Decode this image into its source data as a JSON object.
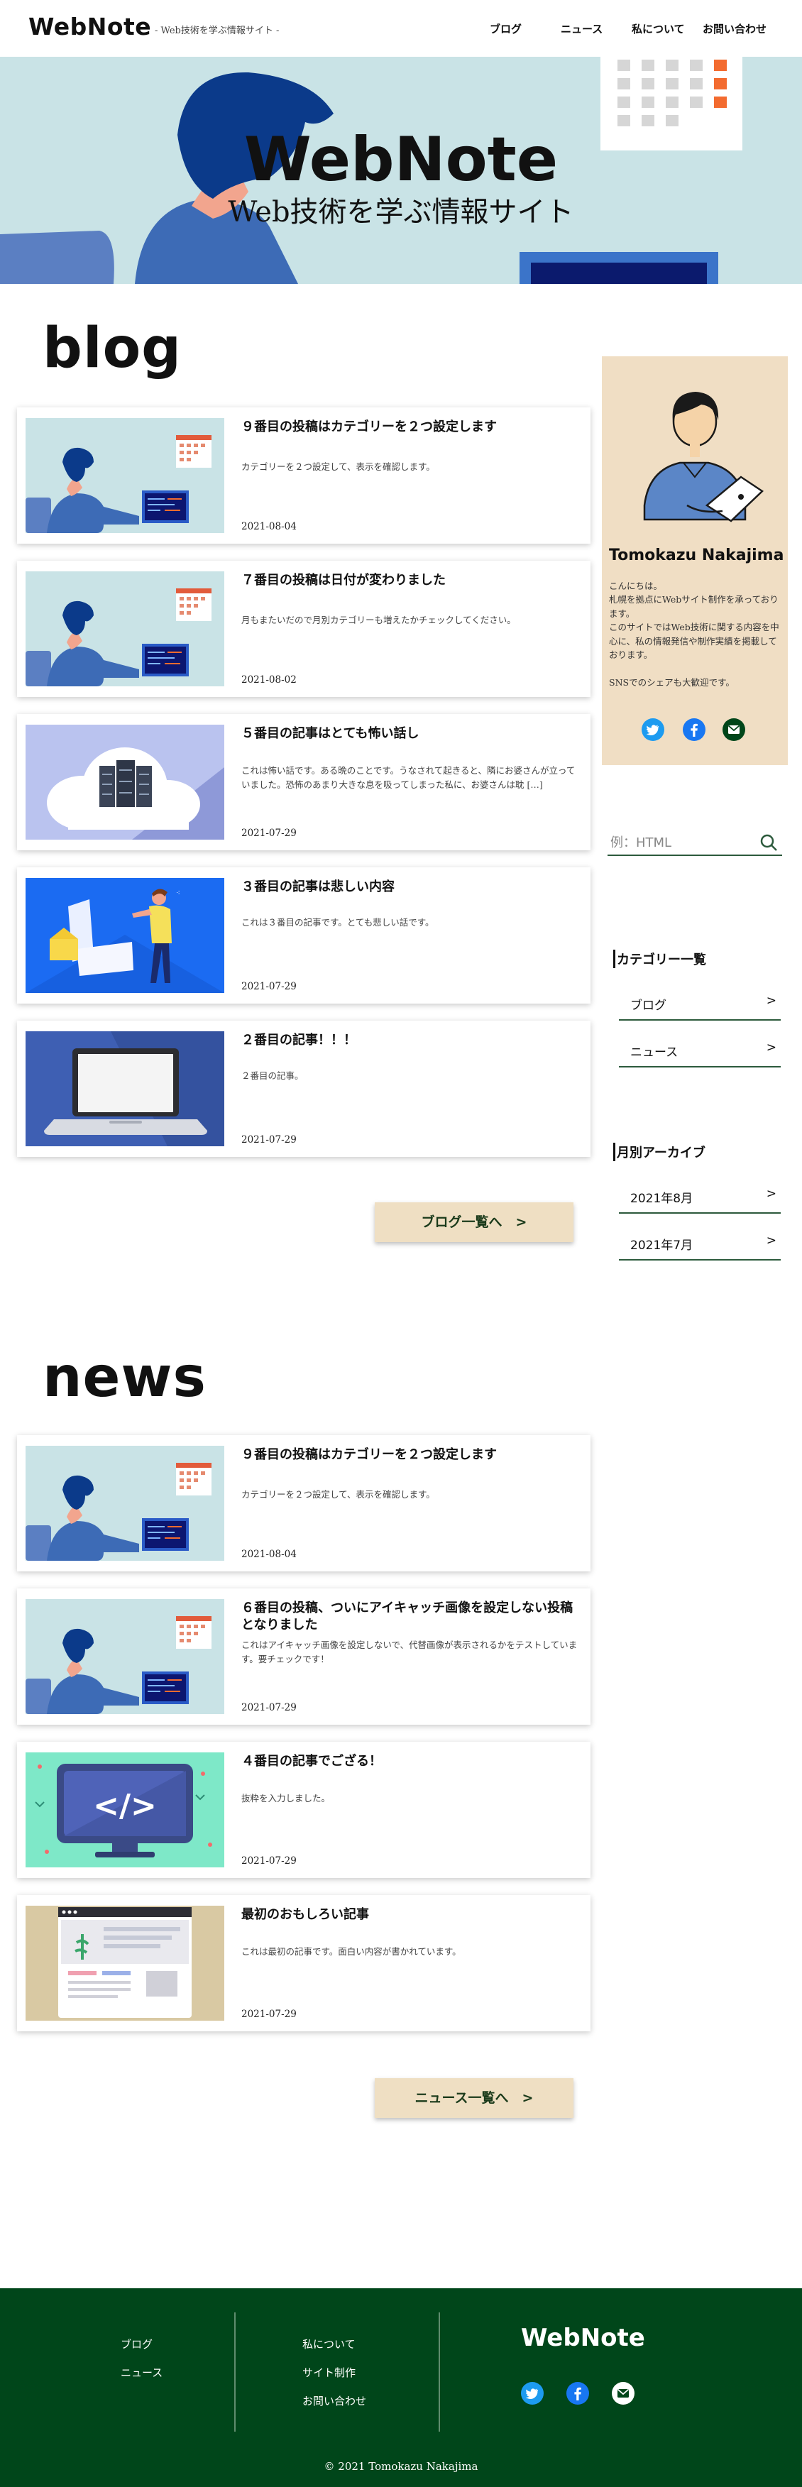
{
  "header": {
    "logo": "WebNote",
    "tagline": "- Web技術を学ぶ情報サイト -",
    "nav": [
      "ブログ",
      "ニュース",
      "私について",
      "お問い合わせ"
    ]
  },
  "hero": {
    "title": "WebNote",
    "subtitle": "Web技術を学ぶ情報サイト"
  },
  "blog": {
    "title": "blog",
    "posts": [
      {
        "title": "９番目の投稿はカテゴリーを２つ設定します",
        "excerpt": "カテゴリーを２つ設定して、表示を確認します。",
        "date": "2021-08-04",
        "thumb": "developer-illustration"
      },
      {
        "title": "７番目の投稿は日付が変わりました",
        "excerpt": "月もまたいだので月別カテゴリーも増えたかチェックしてください。",
        "date": "2021-08-02",
        "thumb": "developer-illustration"
      },
      {
        "title": "５番目の記事はとても怖い話し",
        "excerpt": "これは怖い話です。ある晩のことです。うなされて起きると、隣にお婆さんが立っていました。恐怖のあまり大きな息を吸ってしまった私に、お婆さんは耽 […]",
        "date": "2021-07-29",
        "thumb": "cloud-services-illustration"
      },
      {
        "title": "３番目の記事は悲しい内容",
        "excerpt": "これは３番目の記事です。とても悲しい話です。",
        "date": "2021-07-29",
        "thumb": "person-documents-illustration"
      },
      {
        "title": "２番目の記事！！！",
        "excerpt": "２番目の記事。",
        "date": "2021-07-29",
        "thumb": "laptop-illustration"
      }
    ],
    "more_label": "ブログ一覧へ　>"
  },
  "news": {
    "title": "news",
    "posts": [
      {
        "title": "９番目の投稿はカテゴリーを２つ設定します",
        "excerpt": "カテゴリーを２つ設定して、表示を確認します。",
        "date": "2021-08-04",
        "thumb": "developer-illustration"
      },
      {
        "title": "６番目の投稿、ついにアイキャッチ画像を設定しない投稿となりました",
        "excerpt": "これはアイキャッチ画像を設定しないで、代替画像が表示されるかをテストしています。要チェックです！",
        "date": "2021-07-29",
        "thumb": "developer-illustration"
      },
      {
        "title": "４番目の記事でござる！",
        "excerpt": "抜粋を入力しました。",
        "date": "2021-07-29",
        "thumb": "code-monitor-illustration"
      },
      {
        "title": "最初のおもしろい記事",
        "excerpt": "これは最初の記事です。面白い内容が書かれています。",
        "date": "2021-07-29",
        "thumb": "webpage-illustration"
      }
    ],
    "more_label": "ニュース一覧へ　>"
  },
  "sidebar": {
    "profile": {
      "name": "Tomokazu Nakajima",
      "description": "こんにちは。\n札幌を拠点にWebサイト制作を承っております。\nこのサイトではWeb技術に関する内容を中心に、私の情報発信や制作実績を掲載しております。\n\nSNSでのシェアも大歓迎です。",
      "sns": [
        "twitter-icon",
        "facebook-icon",
        "mail-icon"
      ]
    },
    "search": {
      "placeholder": "例：HTML"
    },
    "categories": {
      "title": "カテゴリー一覧",
      "items": [
        "ブログ",
        "ニュース"
      ]
    },
    "archive": {
      "title": "月別アーカイブ",
      "items": [
        "2021年8月",
        "2021年7月"
      ]
    },
    "arrow": ">"
  },
  "footer": {
    "col1": [
      "ブログ",
      "ニュース"
    ],
    "col2": [
      "私について",
      "サイト制作",
      "お問い合わせ"
    ],
    "logo": "WebNote",
    "copyright": "© 2021 Tomokazu Nakajima"
  },
  "colors": {
    "hero_bg": "#c9e3e6",
    "profile_bg": "#f0dec4",
    "button_bg": "#efdfc3",
    "footer_bg": "#00461a",
    "accent_green": "#2c5a3c"
  }
}
